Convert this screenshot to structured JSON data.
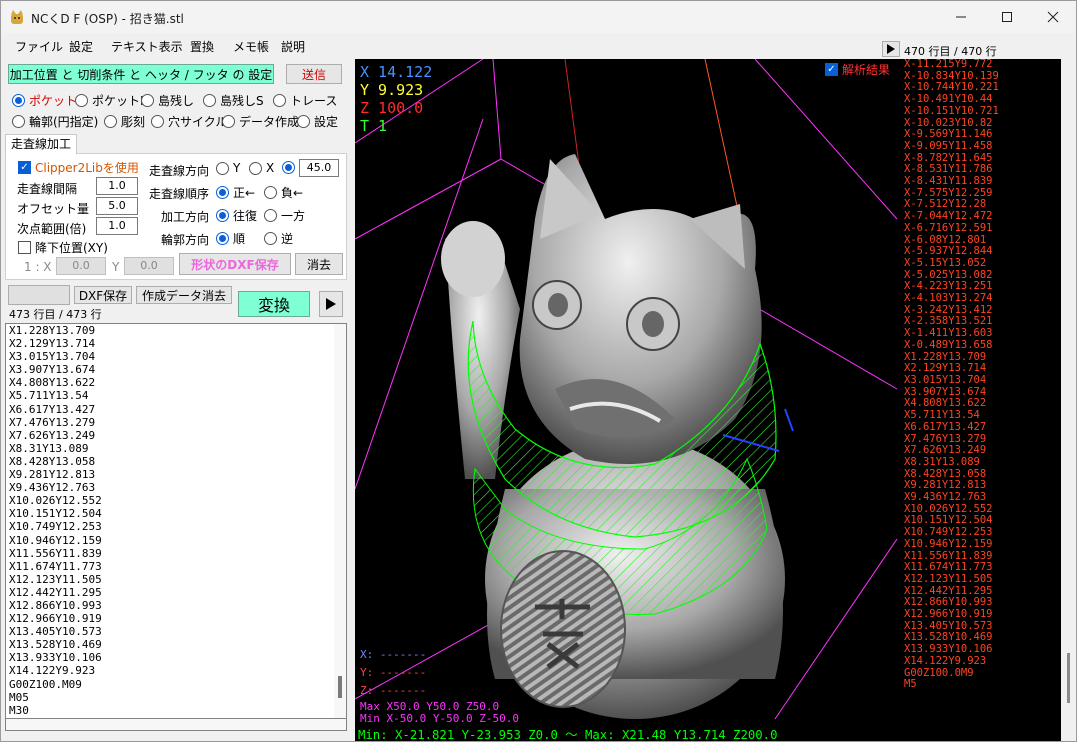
{
  "window": {
    "title": "NCくD F (OSP) - 招き猫.stl"
  },
  "menu": [
    "ファイル",
    "設定",
    "テキスト表示",
    "置換",
    "メモ帳",
    "説明"
  ],
  "top": {
    "settings_button": "加工位置 と 切削条件 と ヘッタ / フッタ の 設定",
    "send_button": "送信"
  },
  "modes": [
    "ポケット",
    "ポケットⅠ",
    "島残し",
    "島残しS",
    "トレース",
    "輪郭(円指定)",
    "彫刻",
    "穴サイクル",
    "データ作成",
    "設定"
  ],
  "tab": {
    "label": "走査線加工"
  },
  "scan": {
    "clipper_label": "Clipper2Libを使用",
    "interval_label": "走査線間隔",
    "interval_value": "1.0",
    "offset_label": "オフセット量",
    "offset_value": "5.0",
    "next_range_label": "次点範囲(倍)",
    "next_range_value": "1.0",
    "direction_label": "走査線方向",
    "dir_y": "Y",
    "dir_x": "X",
    "angle_value": "45.0",
    "order_label": "走査線順序",
    "order_fwd": "正←",
    "order_rev": "負←",
    "cut_dir_label": "加工方向",
    "cut_round": "往復",
    "cut_one": "一方",
    "contour_dir_label": "輪郭方向",
    "contour_fwd": "順",
    "contour_rev": "逆",
    "drop_label": "降下位置(XY)",
    "drop_x_label": "1 : X",
    "drop_x_value": "0.0",
    "drop_y_label": "Y",
    "drop_y_value": "0.0",
    "dxf_shape_button": "形状のDXF保存",
    "clear_button": "消去"
  },
  "actions": {
    "dxf_save": "DXF保存",
    "clear_data": "作成データ消去",
    "convert": "変換",
    "play_icon": "play-icon"
  },
  "left_list": {
    "count": "473 行目 / 473 行",
    "lines": [
      "X1.228Y13.709",
      "X2.129Y13.714",
      "X3.015Y13.704",
      "X3.907Y13.674",
      "X4.808Y13.622",
      "X5.711Y13.54",
      "X6.617Y13.427",
      "X7.476Y13.279",
      "X7.626Y13.249",
      "X8.31Y13.089",
      "X8.428Y13.058",
      "X9.281Y12.813",
      "X9.436Y12.763",
      "X10.026Y12.552",
      "X10.151Y12.504",
      "X10.749Y12.253",
      "X10.946Y12.159",
      "X11.556Y11.839",
      "X11.674Y11.773",
      "X12.123Y11.505",
      "X12.442Y11.295",
      "X12.866Y10.993",
      "X12.966Y10.919",
      "X13.405Y10.573",
      "X13.528Y10.469",
      "X13.933Y10.106",
      "X14.122Y9.923",
      "G00Z100.M09",
      "M05",
      "M30"
    ]
  },
  "viewport": {
    "x_readout": "X 14.122",
    "y_readout": "Y 9.923",
    "z_readout": "Z 100.0",
    "t_readout": "T 1",
    "analysis_label": "解析結果",
    "axis_x_legend": "X: -------",
    "axis_y_legend": "Y: -------",
    "axis_z_legend": "Z: -------",
    "max_text": "Max X50.0 Y50.0 Z50.0",
    "min_text": "Min X-50.0 Y-50.0 Z-50.0",
    "range_text": "Min: X-21.821   Y-23.953   Z0.0 ～ Max: X21.48   Y13.714   Z200.0",
    "colors": {
      "x": "#4a90ff",
      "y": "#ffff33",
      "z": "#ff2a2a",
      "t": "#33ff33",
      "magenta": "#ff33ff",
      "green": "#00ff00"
    }
  },
  "right_list": {
    "count": "470 行目 / 470 行",
    "lines": [
      "X-11.215Y9.772",
      "X-10.834Y10.139",
      "X-10.744Y10.221",
      "X-10.491Y10.44",
      "X-10.151Y10.721",
      "X-10.023Y10.82",
      "X-9.569Y11.146",
      "X-9.095Y11.458",
      "X-8.782Y11.645",
      "X-8.531Y11.786",
      "X-8.431Y11.839",
      "X-7.575Y12.259",
      "X-7.512Y12.28",
      "X-7.044Y12.472",
      "X-6.716Y12.591",
      "X-6.08Y12.801",
      "X-5.937Y12.844",
      "X-5.15Y13.052",
      "X-5.025Y13.082",
      "X-4.223Y13.251",
      "X-4.103Y13.274",
      "X-3.242Y13.412",
      "X-2.358Y13.521",
      "X-1.411Y13.603",
      "X-0.489Y13.658",
      "X1.228Y13.709",
      "X2.129Y13.714",
      "X3.015Y13.704",
      "X3.907Y13.674",
      "X4.808Y13.622",
      "X5.711Y13.54",
      "X6.617Y13.427",
      "X7.476Y13.279",
      "X7.626Y13.249",
      "X8.31Y13.089",
      "X8.428Y13.058",
      "X9.281Y12.813",
      "X9.436Y12.763",
      "X10.026Y12.552",
      "X10.151Y12.504",
      "X10.749Y12.253",
      "X10.946Y12.159",
      "X11.556Y11.839",
      "X11.674Y11.773",
      "X12.123Y11.505",
      "X12.442Y11.295",
      "X12.866Y10.993",
      "X12.966Y10.919",
      "X13.405Y10.573",
      "X13.528Y10.469",
      "X13.933Y10.106",
      "X14.122Y9.923",
      "G00Z100.0M9",
      "M5"
    ]
  }
}
